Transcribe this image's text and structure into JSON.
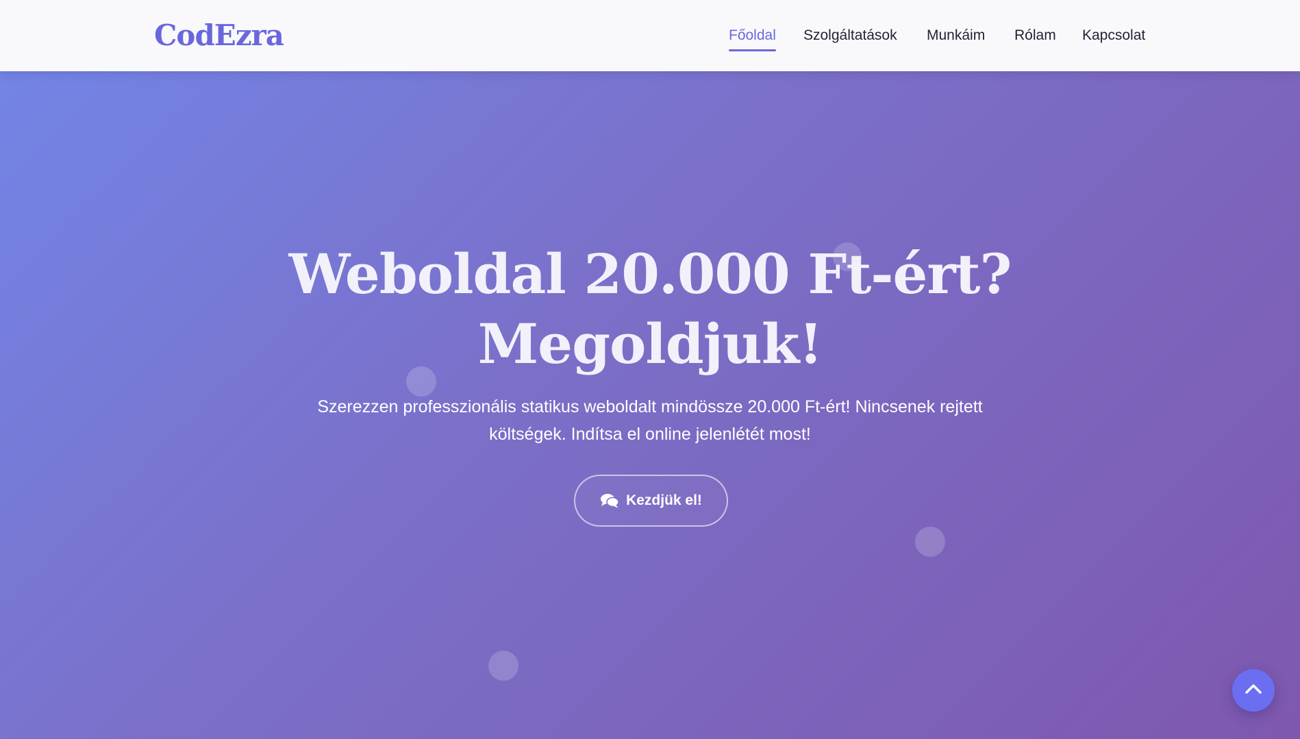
{
  "brand": {
    "logo_text": "CodEzra"
  },
  "nav": {
    "items": [
      {
        "label": "Főoldal",
        "active": true
      },
      {
        "label": "Szolgáltatások",
        "active": false
      },
      {
        "label": "Munkáim",
        "active": false
      },
      {
        "label": "Rólam",
        "active": false
      },
      {
        "label": "Kapcsolat",
        "active": false
      }
    ]
  },
  "hero": {
    "title_line1": "Weboldal 20.000 Ft-ért?",
    "title_line2": "Megoldjuk!",
    "subtitle": "Szerezzen professzionális statikus weboldalt mindössze 20.000 Ft-ért! Nincsenek rejtett költségek. Indítsa el online jelenlétét most!",
    "cta_label": "Kezdjük el!",
    "cta_icon": "chat-bubbles-icon"
  },
  "scroll_top": {
    "icon": "chevron-up-icon"
  },
  "colors": {
    "accent": "#6a67dc",
    "nav_text": "#1f2233",
    "navbar_bg": "#f9f9fc",
    "hero_gradient_start": "#7286e8",
    "hero_gradient_end": "#7e58ae",
    "scroll_button": "#6b6ef0"
  }
}
